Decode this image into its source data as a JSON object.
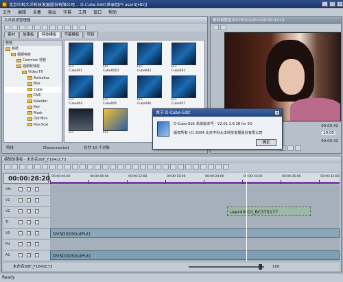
{
  "window": {
    "title": "北京中科大洋科技发展股份有限公司 -- D-Cube-Edit(首录用户:user4[HD])"
  },
  "menu": [
    "文件",
    "编辑",
    "采集",
    "输出",
    "字幕",
    "工具",
    "窗口",
    "帮助"
  ],
  "material_panel": {
    "title": "大洋资源管理器",
    "tabs": [
      "素材",
      "故事板",
      "特技模板",
      "字幕模板",
      "项目"
    ],
    "active_tab": "特技模板",
    "tree_header": "特技",
    "tree": [
      {
        "label": "特技",
        "level": 0
      },
      {
        "label": "视频特技",
        "level": 1
      },
      {
        "label": "Common 特技",
        "level": 2
      },
      {
        "label": "视频软特技",
        "level": 2
      },
      {
        "label": "Video FX",
        "level": 3
      },
      {
        "label": "Ambalisa",
        "level": 4
      },
      {
        "label": "Blur",
        "level": 4
      },
      {
        "label": "Cube",
        "level": 4
      },
      {
        "label": "DVE",
        "level": 4
      },
      {
        "label": "Kaleider",
        "level": 4
      },
      {
        "label": "Key",
        "level": 4
      },
      {
        "label": "Mask",
        "level": 4
      },
      {
        "label": "Old Mov",
        "level": 4
      },
      {
        "label": "Pan-Scal",
        "level": 4
      }
    ],
    "thumbs": [
      {
        "top": "EFF",
        "name": "Cube001"
      },
      {
        "top": "EFF",
        "name": "Cube0010"
      },
      {
        "top": "EFF",
        "name": "Cube002"
      },
      {
        "top": "EFF",
        "name": "Cube003"
      },
      {
        "top": "EFF",
        "name": "Cube004"
      },
      {
        "top": "EFF",
        "name": "Cube005"
      },
      {
        "top": "EFF",
        "name": "Cube006"
      },
      {
        "top": "EFF",
        "name": "Cube007"
      },
      {
        "top": "EFF",
        "name": ""
      },
      {
        "top": "EFF",
        "name": ""
      }
    ],
    "status_left": "特技",
    "status_mid": "Disconnected",
    "status_right": "总共 10 个对象"
  },
  "monitor": {
    "title": "素材调整窗(DSP\\DSOutPut)00:00:42:18",
    "timecode_right_1": "00:00:42",
    "timecode_right_2": "19:05",
    "timecode_right_3": "00:00:42"
  },
  "about_dialog": {
    "title": "关于 D-Cube-Edit",
    "line1": "D-Cube-Edit 系统版本号 - V2.01.1.6.38 for 5G",
    "line2": "版权所有 (C) 2004 北京中科大洋科技发展股份有限公司",
    "ok": "确定"
  },
  "timeline": {
    "title": "编辑故事板 - 未命名SBF_F1641C72",
    "timecode": "00:00:28:20",
    "ruler": [
      "00:00:00:00",
      "00:00:06:00",
      "00:00:12:00",
      "00:00:18:00",
      "00:00:24:00",
      "00:00:30:00",
      "00:00:36:00",
      "00:00:42:00"
    ],
    "tracks": [
      "Vfx",
      "V1",
      "V2",
      "Tr",
      "V3",
      "Pd",
      "A1"
    ],
    "clip_v2": "user4(HD)_BC375177",
    "clip_v3": "DVSD(D3OutPut)",
    "clip_a1": "DVSD(D3OutPut)",
    "footer_tab": "未命名SBF_F1641C72",
    "zoom": "100"
  },
  "statusbar": {
    "text": "Ready"
  },
  "colors": {
    "accent": "#2e4f8c",
    "monitor_bg": "#3a1c16",
    "clip_v3": "#8aa7b8"
  }
}
